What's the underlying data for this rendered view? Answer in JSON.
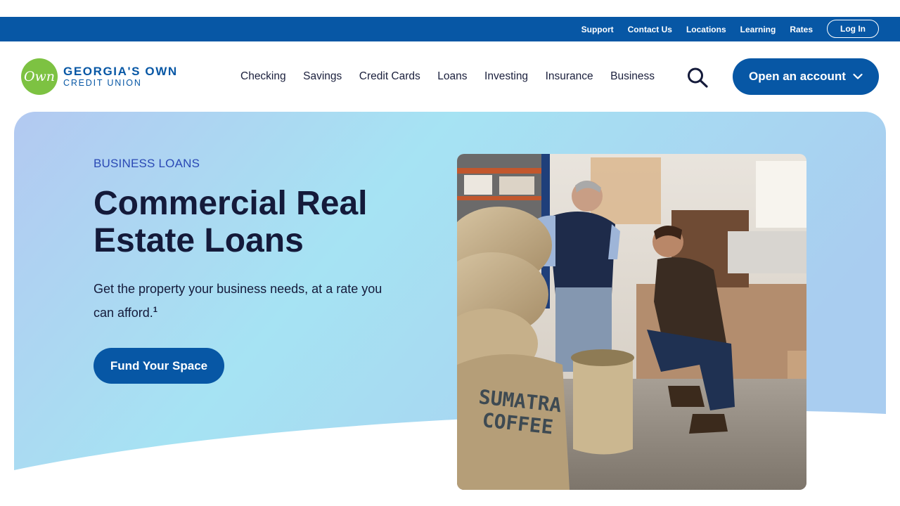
{
  "utility": {
    "links": [
      "Support",
      "Contact Us",
      "Locations",
      "Learning",
      "Rates"
    ],
    "login_label": "Log In"
  },
  "brand": {
    "logo_mark": "Own",
    "name_line1": "GEORGIA'S OWN",
    "name_line2": "CREDIT UNION",
    "primary_color": "#0757a5",
    "logo_green": "#7dc242"
  },
  "nav": {
    "items": [
      "Checking",
      "Savings",
      "Credit Cards",
      "Loans",
      "Investing",
      "Insurance",
      "Business"
    ],
    "search_icon": "search-icon",
    "open_account_label": "Open an account"
  },
  "hero": {
    "eyebrow": "BUSINESS LOANS",
    "title": "Commercial Real Estate Loans",
    "subtitle": "Get the property your business needs, at a rate you can afford.",
    "footnote": "1",
    "cta_label": "Fund Your Space",
    "photo_sack_text_1": "SUMATRA",
    "photo_sack_text_2": "COFFEE"
  }
}
